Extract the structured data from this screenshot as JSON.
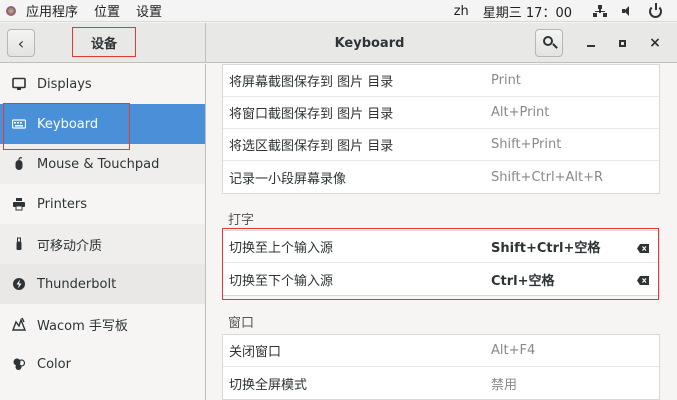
{
  "topbar": {
    "apps": "应用程序",
    "places": "位置",
    "settings": "设置",
    "lang": "zh",
    "clock": "星期三 17：00"
  },
  "header": {
    "sidebar_title": "设备",
    "title": "Keyboard",
    "back_glyph": "‹",
    "close_glyph": "×"
  },
  "sidebar": {
    "items": [
      {
        "label": "Displays",
        "icon": "display-icon"
      },
      {
        "label": "Keyboard",
        "icon": "keyboard-icon",
        "selected": true
      },
      {
        "label": "Mouse & Touchpad",
        "icon": "mouse-icon"
      },
      {
        "label": "Printers",
        "icon": "printer-icon"
      },
      {
        "label": "可移动介质",
        "icon": "usb-media-icon"
      },
      {
        "label": "Thunderbolt",
        "icon": "thunderbolt-icon"
      },
      {
        "label": "Wacom 手写板",
        "icon": "tablet-icon"
      },
      {
        "label": "Color",
        "icon": "color-icon"
      }
    ]
  },
  "screenshots": [
    {
      "name": "将屏幕截图保存到 图片 目录",
      "accel": "Print"
    },
    {
      "name": "将窗口截图保存到 图片 目录",
      "accel": "Alt+Print"
    },
    {
      "name": "将选区截图保存到 图片 目录",
      "accel": "Shift+Print"
    },
    {
      "name": "记录一小段屏幕录像",
      "accel": "Shift+Ctrl+Alt+R"
    }
  ],
  "typing": {
    "title": "打字",
    "rows": [
      {
        "name": "切换至上个输入源",
        "accel": "Shift+Ctrl+空格"
      },
      {
        "name": "切换至下个输入源",
        "accel": "Ctrl+空格"
      }
    ]
  },
  "windows": {
    "title": "窗口",
    "rows": [
      {
        "name": "关闭窗口",
        "accel": "Alt+F4"
      },
      {
        "name": "切换全屏模式",
        "accel": "禁用"
      }
    ]
  }
}
